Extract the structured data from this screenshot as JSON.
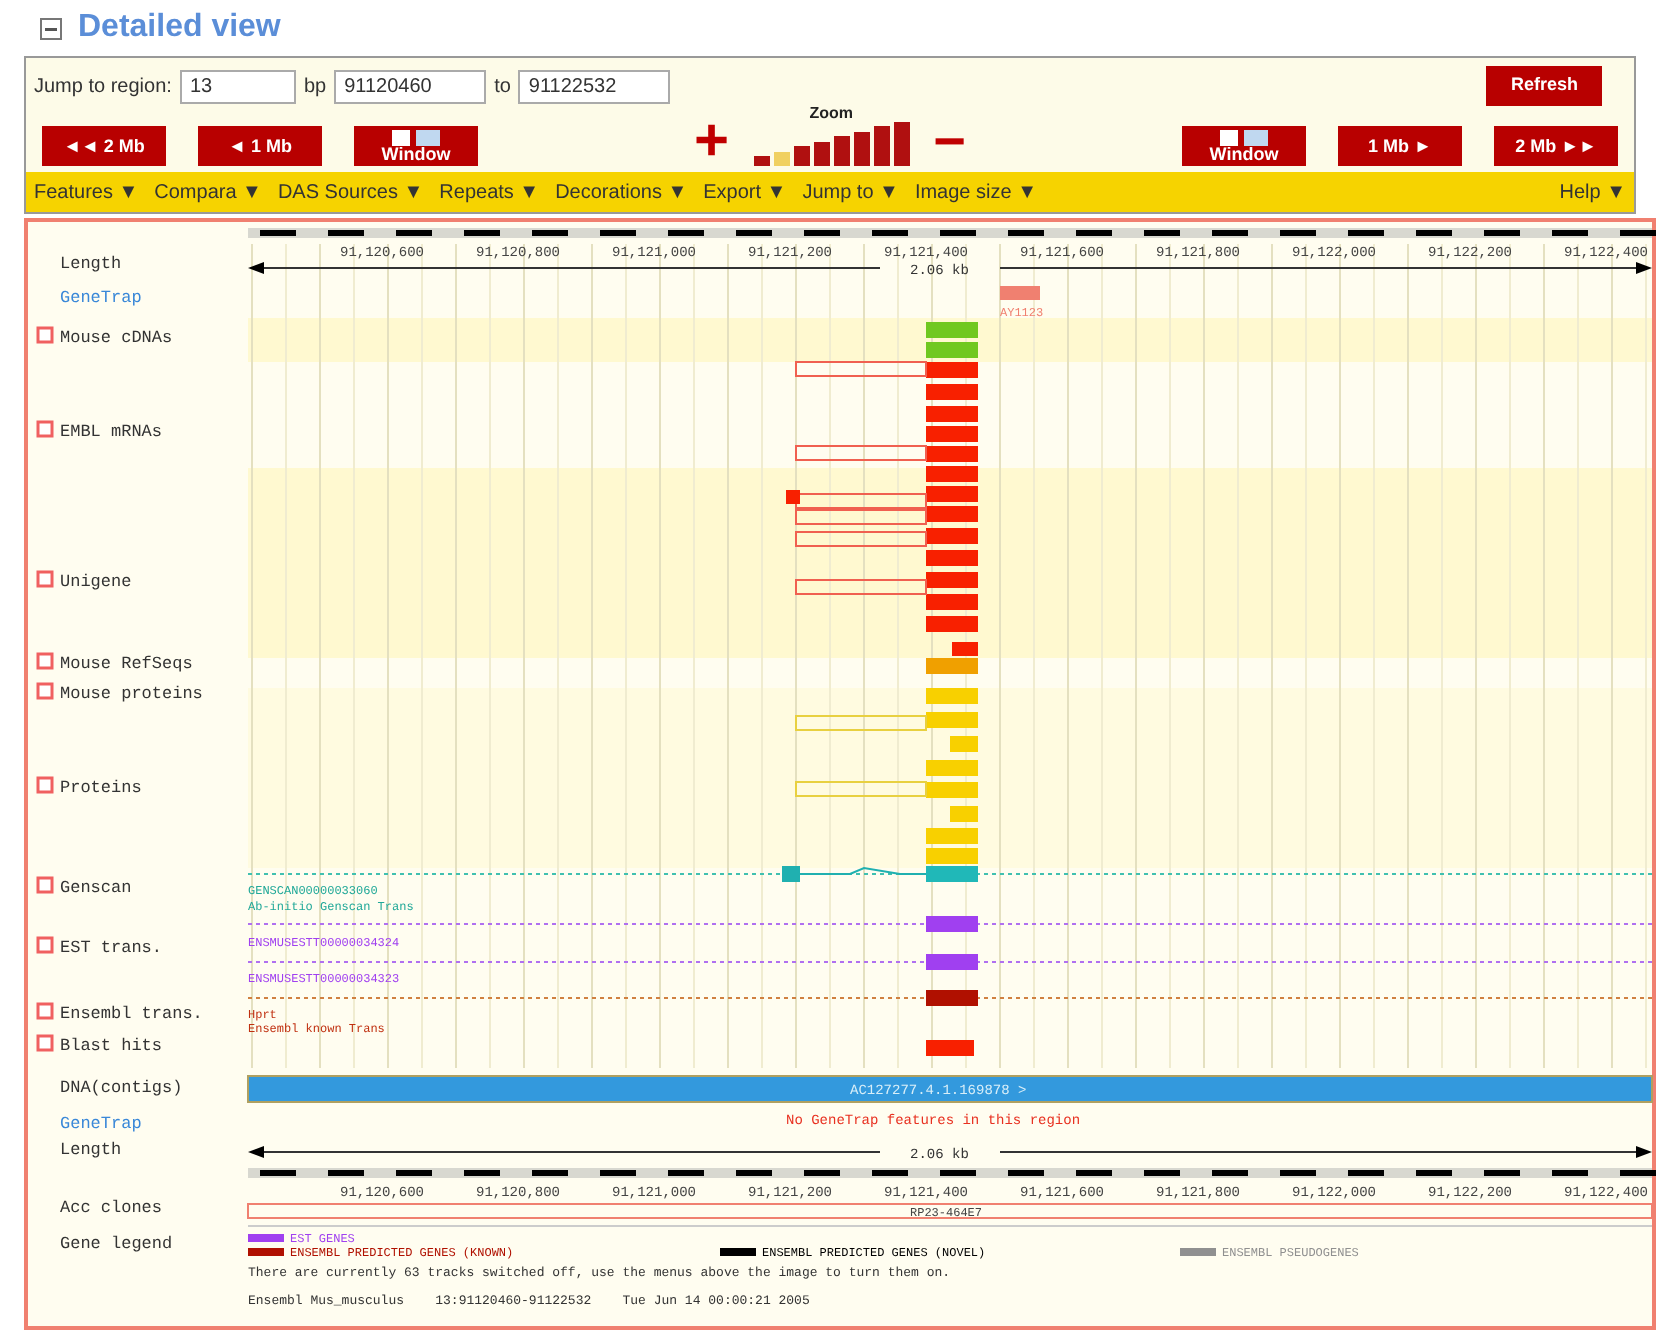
{
  "title": "Detailed view",
  "jump": {
    "label": "Jump to region:",
    "chromosome": "13",
    "bp_label": "bp",
    "start": "91120460",
    "to_label": "to",
    "end": "91122532",
    "refresh": "Refresh"
  },
  "nav_left": [
    {
      "label": "◄◄ 2 Mb",
      "kind": "text"
    },
    {
      "label": "◄ 1 Mb",
      "kind": "text"
    },
    {
      "label": "Window",
      "kind": "window"
    }
  ],
  "zoom": {
    "label": "Zoom",
    "plus": "+",
    "minus": "−",
    "levels": [
      {
        "selected": false
      },
      {
        "selected": true
      },
      {
        "selected": false
      },
      {
        "selected": false
      },
      {
        "selected": false
      },
      {
        "selected": false
      },
      {
        "selected": false
      },
      {
        "selected": false
      }
    ]
  },
  "nav_right": [
    {
      "label": "Window",
      "kind": "window"
    },
    {
      "label": "1 Mb ►",
      "kind": "text"
    },
    {
      "label": "2 Mb ►►",
      "kind": "text"
    }
  ],
  "menus": [
    "Features ▼",
    "Compara ▼",
    "DAS Sources ▼",
    "Repeats ▼",
    "Decorations ▼",
    "Export ▼",
    "Jump to ▼",
    "Image size ▼"
  ],
  "help": "Help ▼",
  "top_ruler_ticks": [
    "91,120,600",
    "91,120,800",
    "91,121,000",
    "91,121,200",
    "91,121,400",
    "91,121,600",
    "91,121,800",
    "91,122,000",
    "91,122,200",
    "91,122,400"
  ],
  "top_length_label": "2.06 kb",
  "bottom_length_label": "2.06 kb",
  "bottom_ruler_ticks": [
    "91,120,600",
    "91,120,800",
    "91,121,000",
    "91,121,200",
    "91,121,400",
    "91,121,600",
    "91,121,800",
    "91,122,000",
    "91,122,200",
    "91,122,400"
  ],
  "tracks": [
    {
      "label": "Length",
      "toggle": false,
      "kind": "plain"
    },
    {
      "label": "GeneTrap",
      "toggle": false,
      "kind": "link"
    },
    {
      "label": "Mouse cDNAs",
      "toggle": true,
      "kind": "plain"
    },
    {
      "label": "EMBL mRNAs",
      "toggle": true,
      "kind": "plain"
    },
    {
      "label": "Unigene",
      "toggle": true,
      "kind": "plain"
    },
    {
      "label": "Mouse RefSeqs",
      "toggle": true,
      "kind": "plain"
    },
    {
      "label": "Mouse proteins",
      "toggle": true,
      "kind": "plain"
    },
    {
      "label": "Proteins",
      "toggle": true,
      "kind": "plain"
    },
    {
      "label": "Genscan",
      "toggle": true,
      "kind": "plain"
    },
    {
      "label": "EST trans.",
      "toggle": true,
      "kind": "plain"
    },
    {
      "label": "Ensembl trans.",
      "toggle": true,
      "kind": "plain"
    },
    {
      "label": "Blast hits",
      "toggle": true,
      "kind": "plain"
    },
    {
      "label": "DNA(contigs)",
      "toggle": false,
      "kind": "plain"
    },
    {
      "label": "GeneTrap",
      "toggle": false,
      "kind": "link"
    },
    {
      "label": "Length",
      "toggle": false,
      "kind": "plain"
    },
    {
      "label": "Acc clones",
      "toggle": false,
      "kind": "plain"
    },
    {
      "label": "Gene legend",
      "toggle": false,
      "kind": "plain"
    }
  ],
  "genetrap_feature": "AY1123",
  "genscan_labels": [
    "GENSCAN00000033060",
    "Ab-initio Genscan Trans"
  ],
  "est_labels": [
    "ENSMUSESTT00000034324",
    "ENSMUSESTT00000034323"
  ],
  "ensembl_labels": [
    "Hprt",
    "Ensembl known Trans"
  ],
  "contig_label": "AC127277.4.1.169878 >",
  "no_genetrap": "No GeneTrap features in this region",
  "acc_clone": "RP23-464E7",
  "legend": [
    {
      "label": "EST GENES",
      "color": "#a040f0"
    },
    {
      "label": "ENSEMBL PREDICTED GENES (KNOWN)",
      "color": "#b01000"
    },
    {
      "label": "ENSEMBL PREDICTED GENES (NOVEL)",
      "color": "#000000"
    },
    {
      "label": "ENSEMBL PSEUDOGENES",
      "color": "#909090"
    }
  ],
  "footer": [
    "There are currently 63 tracks switched off, use the menus above the image to turn them on.",
    "Ensembl Mus_musculus    13:91120460-91122532    Tue Jun 14 00:00:21 2005"
  ]
}
